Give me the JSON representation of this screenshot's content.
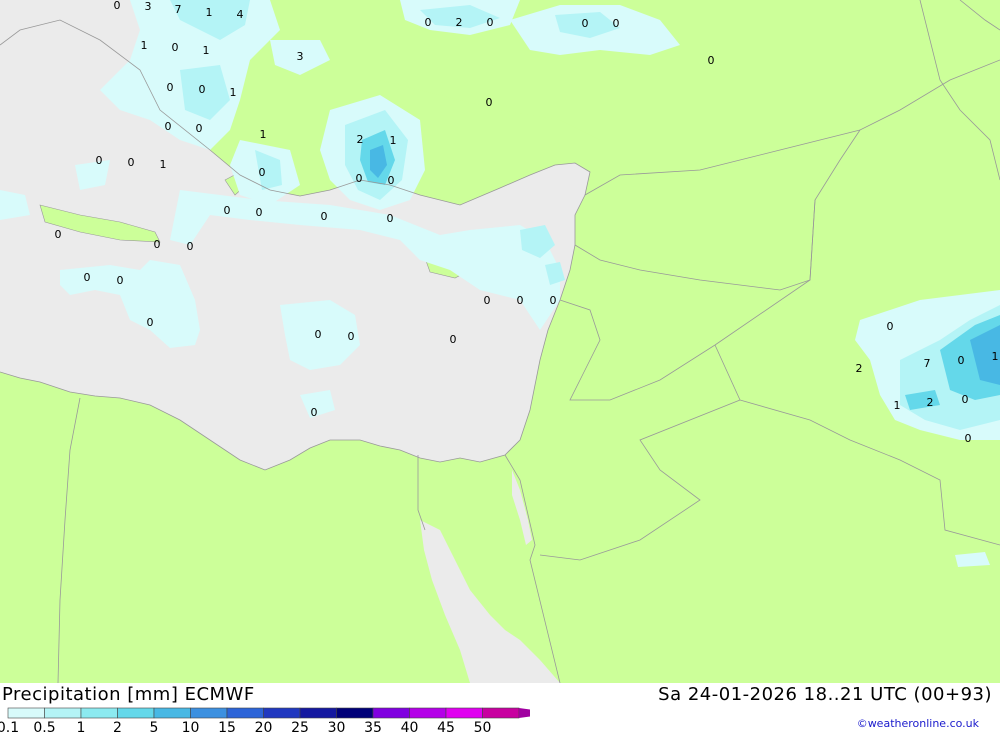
{
  "footer": {
    "title": "Precipitation [mm] ECMWF",
    "datetime": "Sa 24-01-2026 18..21 UTC (00+93)",
    "credit": "©weatheronline.co.uk"
  },
  "colors": {
    "land": "#ccff99",
    "sea": "#ebebeb",
    "border": "#999999"
  },
  "legend": {
    "labels": [
      "0.1",
      "0.5",
      "1",
      "2",
      "5",
      "10",
      "15",
      "20",
      "25",
      "30",
      "35",
      "40",
      "45",
      "50"
    ],
    "colors": [
      "#d8fbfb",
      "#b4f4f6",
      "#8ceaf0",
      "#64d8ea",
      "#48b8e4",
      "#3c90e0",
      "#2c64d8",
      "#2038c0",
      "#1418a0",
      "#000078",
      "#8000e0",
      "#b400e8",
      "#e000f0",
      "#c800a0"
    ]
  },
  "map_values": [
    "0",
    "3",
    "7",
    "1",
    "4",
    "0",
    "2",
    "0",
    "0",
    "0",
    "0",
    "1",
    "0",
    "1",
    "3",
    "0",
    "0",
    "1",
    "0",
    "0",
    "0",
    "1",
    "2",
    "1",
    "0",
    "0",
    "1",
    "0",
    "0",
    "0",
    "0",
    "0",
    "0",
    "0",
    "0",
    "0",
    "0",
    "0",
    "0",
    "0",
    "0",
    "0",
    "0",
    "0",
    "0",
    "0",
    "0",
    "0",
    "2",
    "7",
    "0",
    "1",
    "1",
    "2",
    "0",
    "0"
  ]
}
